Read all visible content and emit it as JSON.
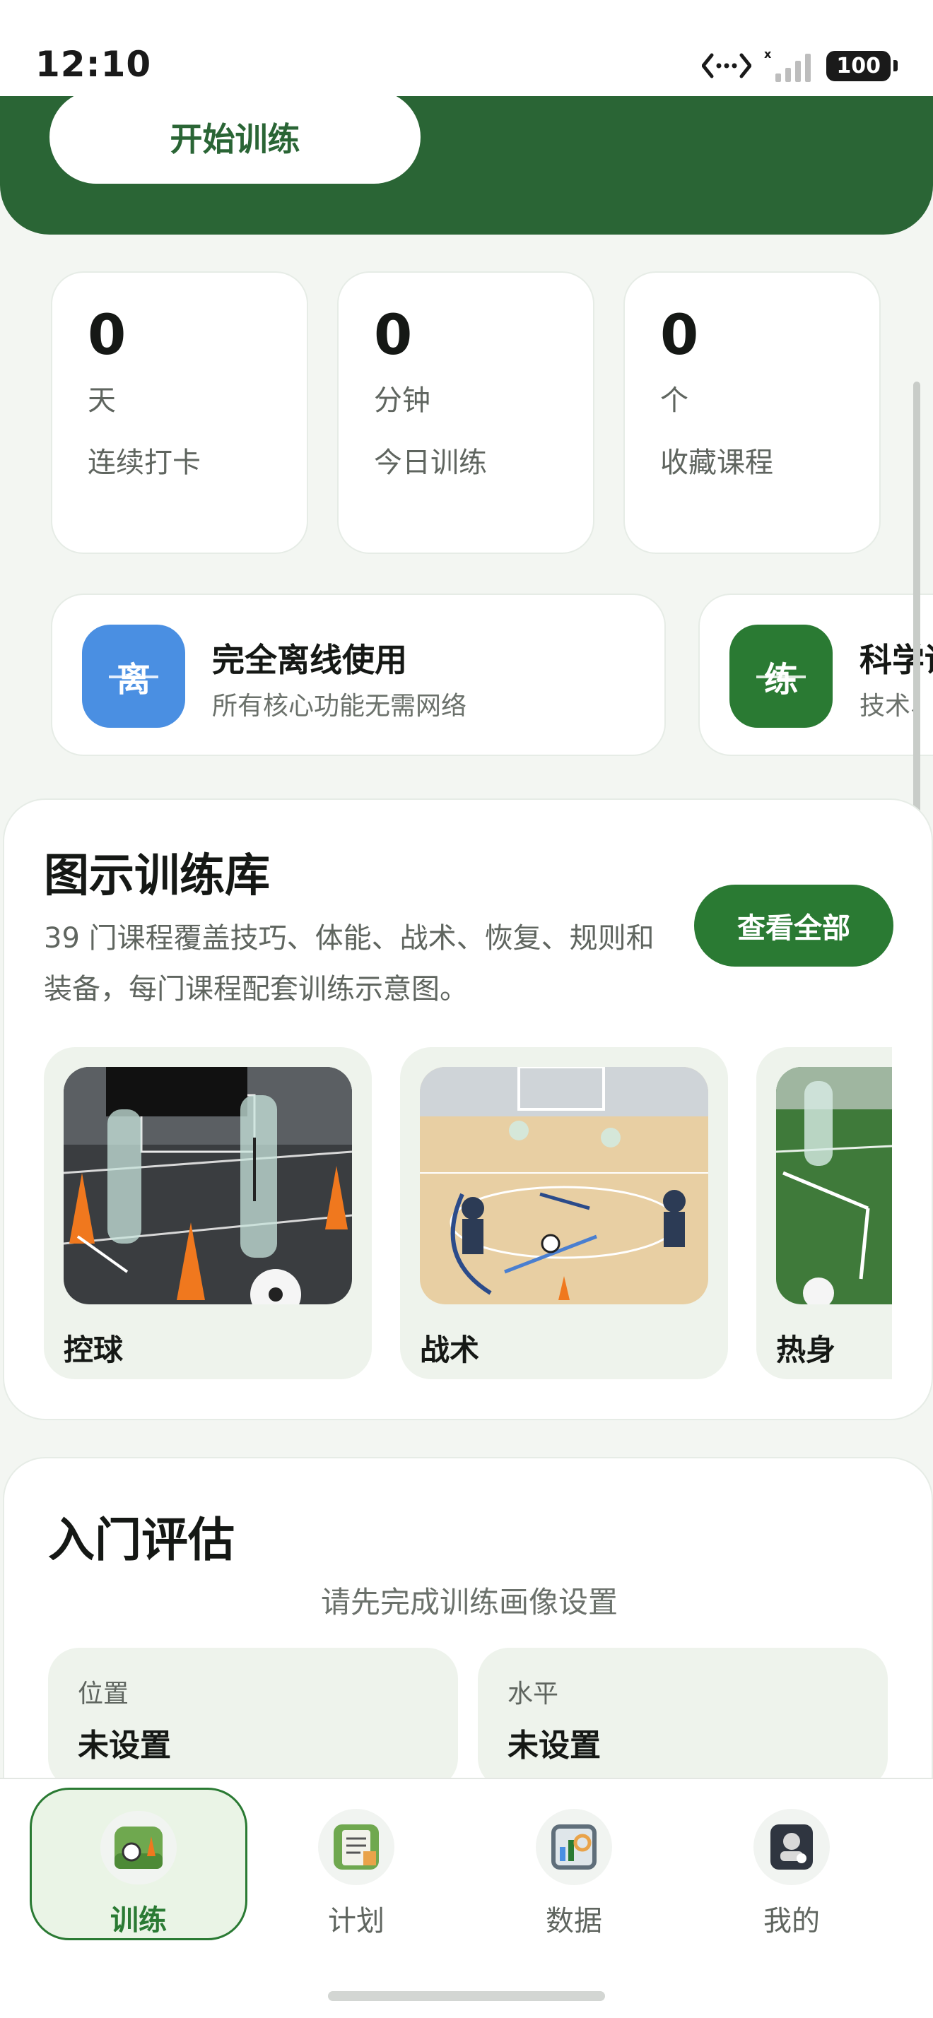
{
  "status_bar": {
    "time": "12:10",
    "battery": "100"
  },
  "hero": {
    "start_button": "开始训练"
  },
  "stats": [
    {
      "value": "0",
      "unit": "天",
      "label": "连续打卡"
    },
    {
      "value": "0",
      "unit": "分钟",
      "label": "今日训练"
    },
    {
      "value": "0",
      "unit": "个",
      "label": "收藏课程"
    }
  ],
  "features": [
    {
      "icon_char": "离",
      "title": "完全离线使用",
      "subtitle": "所有核心功能无需网络",
      "color": "#4a8fe2"
    },
    {
      "icon_char": "练",
      "title": "科学训练",
      "subtitle": "技术、",
      "color": "#2a7a33"
    }
  ],
  "library": {
    "title": "图示训练库",
    "description": "39 门课程覆盖技巧、体能、战术、恢复、规则和装备，每门课程配套训练示意图。",
    "view_all": "查看全部",
    "courses": [
      {
        "name": "控球"
      },
      {
        "name": "战术"
      },
      {
        "name": "热身"
      }
    ]
  },
  "assessment": {
    "title": "入门评估",
    "hint": "请先完成训练画像设置",
    "items": [
      {
        "key": "位置",
        "value": "未设置"
      },
      {
        "key": "水平",
        "value": "未设置"
      }
    ]
  },
  "tabs": [
    {
      "label": "训练",
      "icon": "training-icon",
      "active": true
    },
    {
      "label": "计划",
      "icon": "plan-icon",
      "active": false
    },
    {
      "label": "数据",
      "icon": "data-icon",
      "active": false
    },
    {
      "label": "我的",
      "icon": "profile-icon",
      "active": false
    }
  ],
  "colors": {
    "brand_green": "#2a6535",
    "accent_green": "#2a7a33",
    "blue": "#4a8fe2"
  }
}
